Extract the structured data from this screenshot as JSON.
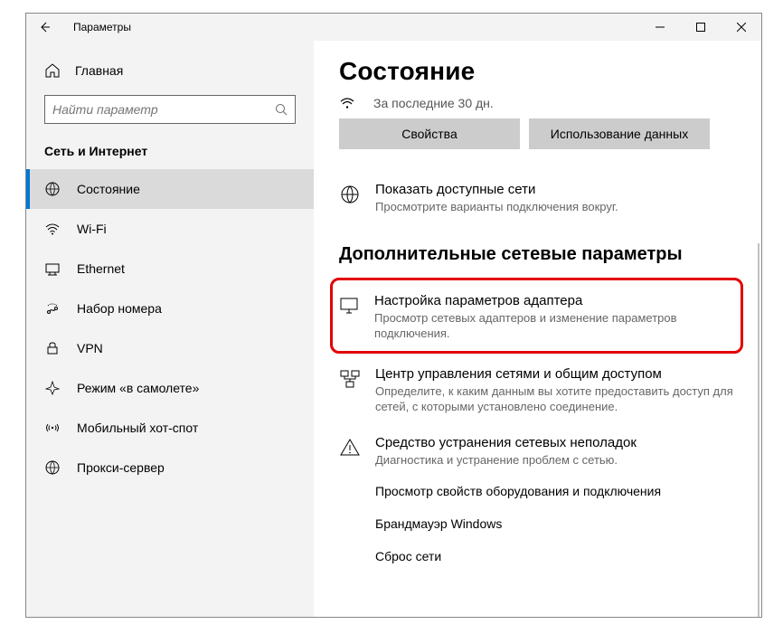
{
  "window": {
    "title": "Параметры"
  },
  "sidebar": {
    "home": "Главная",
    "search_placeholder": "Найти параметр",
    "category": "Сеть и Интернет",
    "items": [
      {
        "icon": "status",
        "label": "Состояние",
        "active": true
      },
      {
        "icon": "wifi",
        "label": "Wi-Fi"
      },
      {
        "icon": "ethernet",
        "label": "Ethernet"
      },
      {
        "icon": "dialup",
        "label": "Набор номера"
      },
      {
        "icon": "vpn",
        "label": "VPN"
      },
      {
        "icon": "airplane",
        "label": "Режим «в самолете»"
      },
      {
        "icon": "hotspot",
        "label": "Мобильный хот-спот"
      },
      {
        "icon": "proxy",
        "label": "Прокси-сервер"
      }
    ]
  },
  "content": {
    "heading": "Состояние",
    "meta": "За последние 30 дн.",
    "buttons": {
      "properties": "Свойства",
      "usage": "Использование данных"
    },
    "tiles": [
      {
        "title": "Показать доступные сети",
        "desc": "Просмотрите варианты подключения вокруг."
      }
    ],
    "section_heading": "Дополнительные сетевые параметры",
    "tiles2": [
      {
        "title": "Настройка параметров адаптера",
        "desc": "Просмотр сетевых адаптеров и изменение параметров подключения."
      },
      {
        "title": "Центр управления сетями и общим доступом",
        "desc": "Определите, к каким данным вы хотите предоставить доступ для сетей, с которыми установлено соединение."
      },
      {
        "title": "Средство устранения сетевых неполадок",
        "desc": "Диагностика и устранение проблем с сетью."
      }
    ],
    "links": [
      "Просмотр свойств оборудования и подключения",
      "Брандмауэр Windows",
      "Сброс сети"
    ]
  }
}
